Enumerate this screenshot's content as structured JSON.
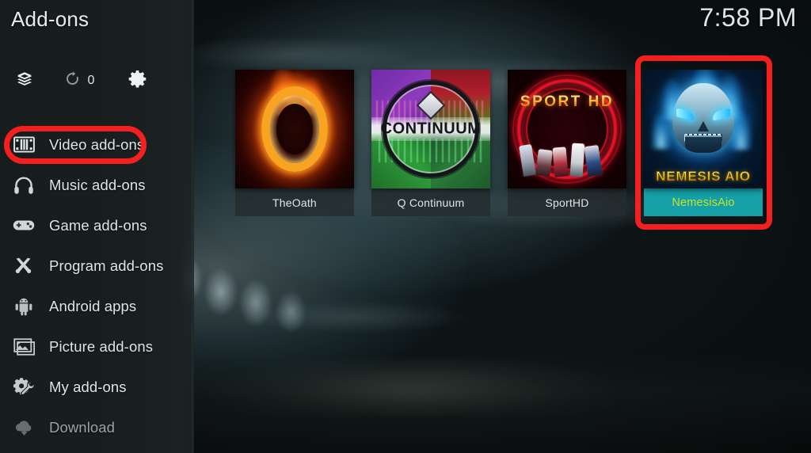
{
  "header": {
    "title": "Add-ons",
    "clock": "7:58 PM"
  },
  "toolbar": {
    "addons_icon": "box-icon",
    "update_icon": "refresh-icon",
    "update_count": "0",
    "settings_icon": "gear-icon"
  },
  "sidebar": {
    "items": [
      {
        "label": "Video add-ons",
        "icon": "film-strip-icon",
        "selected": true,
        "dim": false
      },
      {
        "label": "Music add-ons",
        "icon": "headphones-icon",
        "selected": false,
        "dim": false
      },
      {
        "label": "Game add-ons",
        "icon": "gamepad-icon",
        "selected": false,
        "dim": false
      },
      {
        "label": "Program add-ons",
        "icon": "tools-icon",
        "selected": false,
        "dim": false
      },
      {
        "label": "Android apps",
        "icon": "android-icon",
        "selected": false,
        "dim": false
      },
      {
        "label": "Picture add-ons",
        "icon": "picture-icon",
        "selected": false,
        "dim": false
      },
      {
        "label": "My add-ons",
        "icon": "gear-wrench-icon",
        "selected": false,
        "dim": false
      },
      {
        "label": "Download",
        "icon": "cloud-download-icon",
        "selected": false,
        "dim": true
      }
    ]
  },
  "main": {
    "tiles": [
      {
        "label": "TheOath",
        "art": "oath",
        "selected": false,
        "art_text": ""
      },
      {
        "label": "Q Continuum",
        "art": "cont",
        "selected": false,
        "art_text": "CONTINUUM"
      },
      {
        "label": "SportHD",
        "art": "sport",
        "selected": false,
        "art_text": "SPORT HD"
      },
      {
        "label": "NemesisAio",
        "art": "nemesis",
        "selected": true,
        "art_text": "NEMESIS AIO"
      }
    ]
  },
  "annotations": {
    "color": "#f42020",
    "sidebar_target": "Video add-ons",
    "tile_target": "NemesisAio"
  },
  "colors": {
    "sidebar_bg": "#191f1f",
    "selected_tile_label_bg": "#16a0a8",
    "selected_tile_label_text": "#c9e324",
    "tile_label_bg": "rgba(36,44,46,0.80)",
    "text": "#dfe5e6",
    "annotation_red": "#f42020"
  }
}
